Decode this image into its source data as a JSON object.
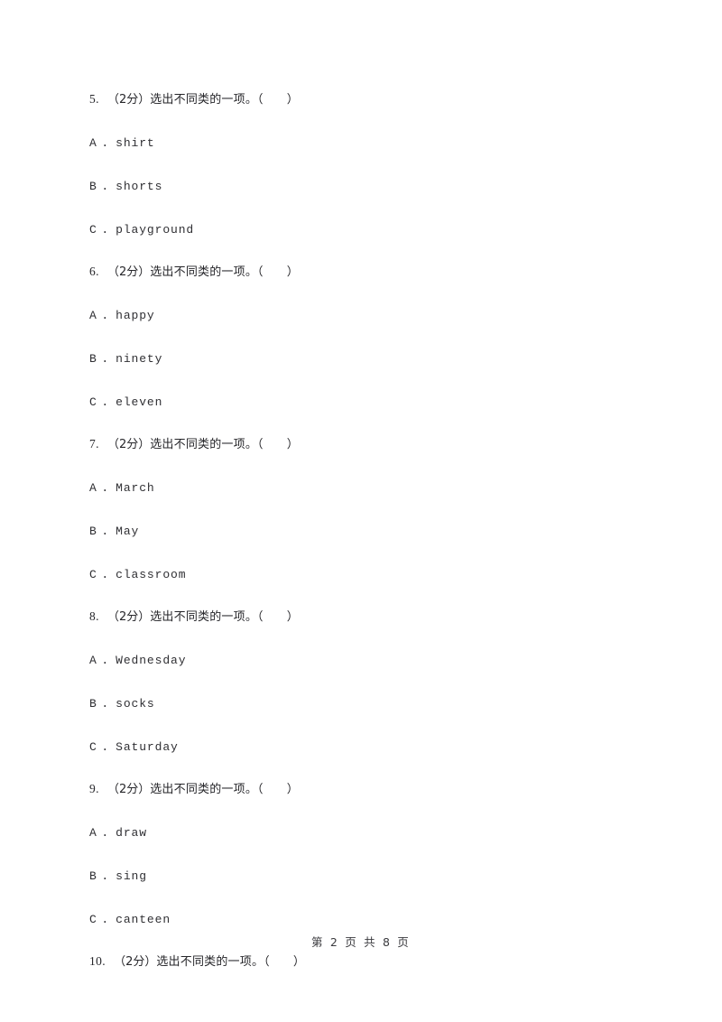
{
  "document": {
    "page_footer": "第 2 页 共 8 页",
    "page_number": "2",
    "total_pages": "8"
  },
  "questions": [
    {
      "number": "5.",
      "score": "（2分）",
      "prompt": "选出不同类的一项。（",
      "prompt_close": "）",
      "options": [
        {
          "letter": "A",
          "dot": ".",
          "text": "shirt"
        },
        {
          "letter": "B",
          "dot": ".",
          "text": "shorts"
        },
        {
          "letter": "C",
          "dot": ".",
          "text": "playground"
        }
      ]
    },
    {
      "number": "6.",
      "score": "（2分）",
      "prompt": "选出不同类的一项。（",
      "prompt_close": "）",
      "options": [
        {
          "letter": "A",
          "dot": ".",
          "text": "happy"
        },
        {
          "letter": "B",
          "dot": ".",
          "text": "ninety"
        },
        {
          "letter": "C",
          "dot": ".",
          "text": "eleven"
        }
      ]
    },
    {
      "number": "7.",
      "score": "（2分）",
      "prompt": "选出不同类的一项。（",
      "prompt_close": "）",
      "options": [
        {
          "letter": "A",
          "dot": ".",
          "text": "March"
        },
        {
          "letter": "B",
          "dot": ".",
          "text": "May"
        },
        {
          "letter": "C",
          "dot": ".",
          "text": "classroom"
        }
      ]
    },
    {
      "number": "8.",
      "score": "（2分）",
      "prompt": "选出不同类的一项。（",
      "prompt_close": "）",
      "options": [
        {
          "letter": "A",
          "dot": ".",
          "text": "Wednesday"
        },
        {
          "letter": "B",
          "dot": ".",
          "text": "socks"
        },
        {
          "letter": "C",
          "dot": ".",
          "text": "Saturday"
        }
      ]
    },
    {
      "number": "9.",
      "score": "（2分）",
      "prompt": "选出不同类的一项。（",
      "prompt_close": "）",
      "options": [
        {
          "letter": "A",
          "dot": ".",
          "text": "draw"
        },
        {
          "letter": "B",
          "dot": ".",
          "text": "sing"
        },
        {
          "letter": "C",
          "dot": ".",
          "text": "canteen"
        }
      ]
    },
    {
      "number": "10.",
      "score": "（2分）",
      "prompt": "选出不同类的一项。（",
      "prompt_close": "）",
      "options": []
    }
  ]
}
